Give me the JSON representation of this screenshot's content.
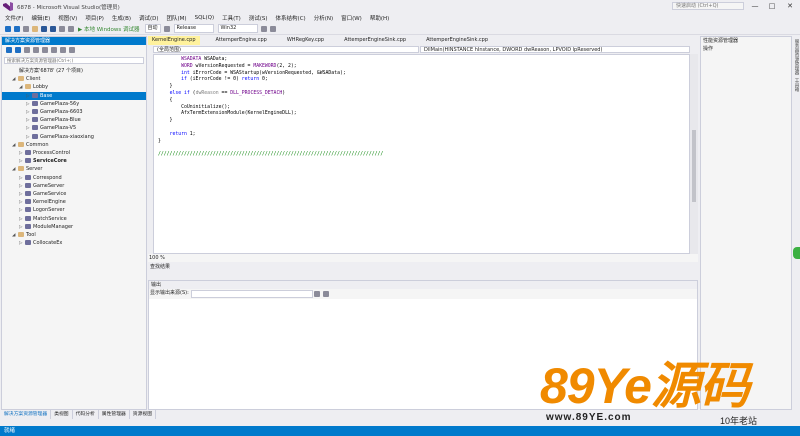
{
  "window": {
    "title": "6878 - Microsoft Visual Studio(管理员)",
    "quick_launch_placeholder": "快速启动 (Ctrl+Q)",
    "controls": [
      "—",
      "□",
      "✕"
    ]
  },
  "menu": [
    "文件(F)",
    "编辑(E)",
    "视图(V)",
    "项目(P)",
    "生成(B)",
    "调试(D)",
    "团队(M)",
    "SQL(Q)",
    "工具(T)",
    "测试(S)",
    "体系结构(C)",
    "分析(N)",
    "窗口(W)",
    "帮助(H)"
  ],
  "toolbar": {
    "run_label": "▶ 本地 Windows 调试器",
    "run_mode": "自动",
    "configuration": "Release",
    "platform": "Win32"
  },
  "solution_explorer": {
    "title": "解决方案资源管理器",
    "search_placeholder": "搜索解决方案资源管理器(Ctrl+;)",
    "nodes": [
      {
        "label": "解决方案'6878' (27 个项目)",
        "type": "solution",
        "level": 0,
        "exp": ""
      },
      {
        "label": "Client",
        "type": "folder",
        "level": 1,
        "exp": "◢"
      },
      {
        "label": "Lobby",
        "type": "folder",
        "level": 2,
        "exp": "◢"
      },
      {
        "label": "Base",
        "type": "proj",
        "level": 3,
        "exp": "▷",
        "selected": true
      },
      {
        "label": "GamePlaza-56y",
        "type": "proj",
        "level": 3,
        "exp": "▷"
      },
      {
        "label": "GamePlaza-6603",
        "type": "proj",
        "level": 3,
        "exp": "▷"
      },
      {
        "label": "GamePlaza-Blue",
        "type": "proj",
        "level": 3,
        "exp": "▷"
      },
      {
        "label": "GamePlaza-V5",
        "type": "proj",
        "level": 3,
        "exp": "▷"
      },
      {
        "label": "GamePlaza-xiaoxiang",
        "type": "proj",
        "level": 3,
        "exp": "▷"
      },
      {
        "label": "Common",
        "type": "folder",
        "level": 1,
        "exp": "◢"
      },
      {
        "label": "ProcessControl",
        "type": "proj",
        "level": 2,
        "exp": "▷"
      },
      {
        "label": "ServiceCore",
        "type": "proj",
        "level": 2,
        "exp": "▷",
        "bold": true
      },
      {
        "label": "Server",
        "type": "folder",
        "level": 1,
        "exp": "◢"
      },
      {
        "label": "Correspond",
        "type": "proj",
        "level": 2,
        "exp": "▷"
      },
      {
        "label": "GameServer",
        "type": "proj",
        "level": 2,
        "exp": "▷"
      },
      {
        "label": "GameService",
        "type": "proj",
        "level": 2,
        "exp": "▷"
      },
      {
        "label": "KernelEngine",
        "type": "proj",
        "level": 2,
        "exp": "▷"
      },
      {
        "label": "LogonServer",
        "type": "proj",
        "level": 2,
        "exp": "▷"
      },
      {
        "label": "MatchService",
        "type": "proj",
        "level": 2,
        "exp": "▷"
      },
      {
        "label": "ModuleManager",
        "type": "proj",
        "level": 2,
        "exp": "▷"
      },
      {
        "label": "Tool",
        "type": "folder",
        "level": 1,
        "exp": "◢"
      },
      {
        "label": "CollocateEx",
        "type": "proj",
        "level": 2,
        "exp": "▷"
      }
    ],
    "bottom_tabs": [
      "解决方案资源管理器",
      "类视图",
      "代码分析",
      "属性管理器",
      "资源视图"
    ]
  },
  "editor": {
    "tabs": [
      "KernelEngine.cpp",
      "AttemperEngine.cpp",
      "WHRegKey.cpp",
      "AttemperEngineSink.cpp",
      "AttemperEngineSink.cpp"
    ],
    "active_tab": 0,
    "scope": "(全局范围)",
    "function": "DllMain(HINSTANCE hInstance, DWORD dwReason, LPVOID lpReserved)",
    "zoom": "100 %",
    "code_lines": [
      [
        [
          "        ",
          ""
        ],
        [
          "WSADATA",
          "mac"
        ],
        [
          " WSAData;",
          ""
        ]
      ],
      [
        [
          "        ",
          ""
        ],
        [
          "WORD",
          "mac"
        ],
        [
          " wVersionRequested = ",
          ""
        ],
        [
          "MAKEWORD",
          "mac"
        ],
        [
          "(2, 2);",
          ""
        ]
      ],
      [
        [
          "        ",
          ""
        ],
        [
          "int",
          "kw"
        ],
        [
          " iErrorCode = WSAStartup(wVersionRequested, &WSAData);",
          ""
        ]
      ],
      [
        [
          "        ",
          ""
        ],
        [
          "if",
          "kw"
        ],
        [
          " (iErrorCode != 0) ",
          ""
        ],
        [
          "return",
          "kw"
        ],
        [
          " 0;",
          ""
        ]
      ],
      [
        [
          "    }",
          ""
        ]
      ],
      [
        [
          "    ",
          ""
        ],
        [
          "else if",
          "kw"
        ],
        [
          " (",
          ""
        ],
        [
          "dwReason",
          "var"
        ],
        [
          " == ",
          ""
        ],
        [
          "DLL_PROCESS_DETACH",
          "mac"
        ],
        [
          ")",
          ""
        ]
      ],
      [
        [
          "    {",
          ""
        ]
      ],
      [
        [
          "        CoUninitialize();",
          ""
        ]
      ],
      [
        [
          "        AfxTermExtensionModule(KernelEngineDLL);",
          ""
        ]
      ],
      [
        [
          "    }",
          ""
        ]
      ],
      [
        [
          "",
          ""
        ]
      ],
      [
        [
          "    ",
          ""
        ],
        [
          "return",
          "kw"
        ],
        [
          " 1;",
          ""
        ]
      ],
      [
        [
          "}",
          ""
        ]
      ],
      [
        [
          "",
          ""
        ]
      ],
      [
        [
          "//////////////////////////////////////////////////////////////////////////////",
          "cm"
        ]
      ]
    ]
  },
  "find_results": {
    "title": "查找结果"
  },
  "output": {
    "title": "输出",
    "source_label": "显示输出来源(S):"
  },
  "right_panel": {
    "title": "性能资源管理器",
    "subtitle": "操作",
    "strip": [
      "服务器资源管理器",
      "工具箱"
    ]
  },
  "status": {
    "text": "就绪"
  },
  "watermark": {
    "big": "89Ye源码",
    "url": "www.89YE.com",
    "tag": "10年老站"
  },
  "colors": {
    "accent": "#007ACC",
    "active_tab": "#FFF29D",
    "watermark": "#F08A00"
  }
}
